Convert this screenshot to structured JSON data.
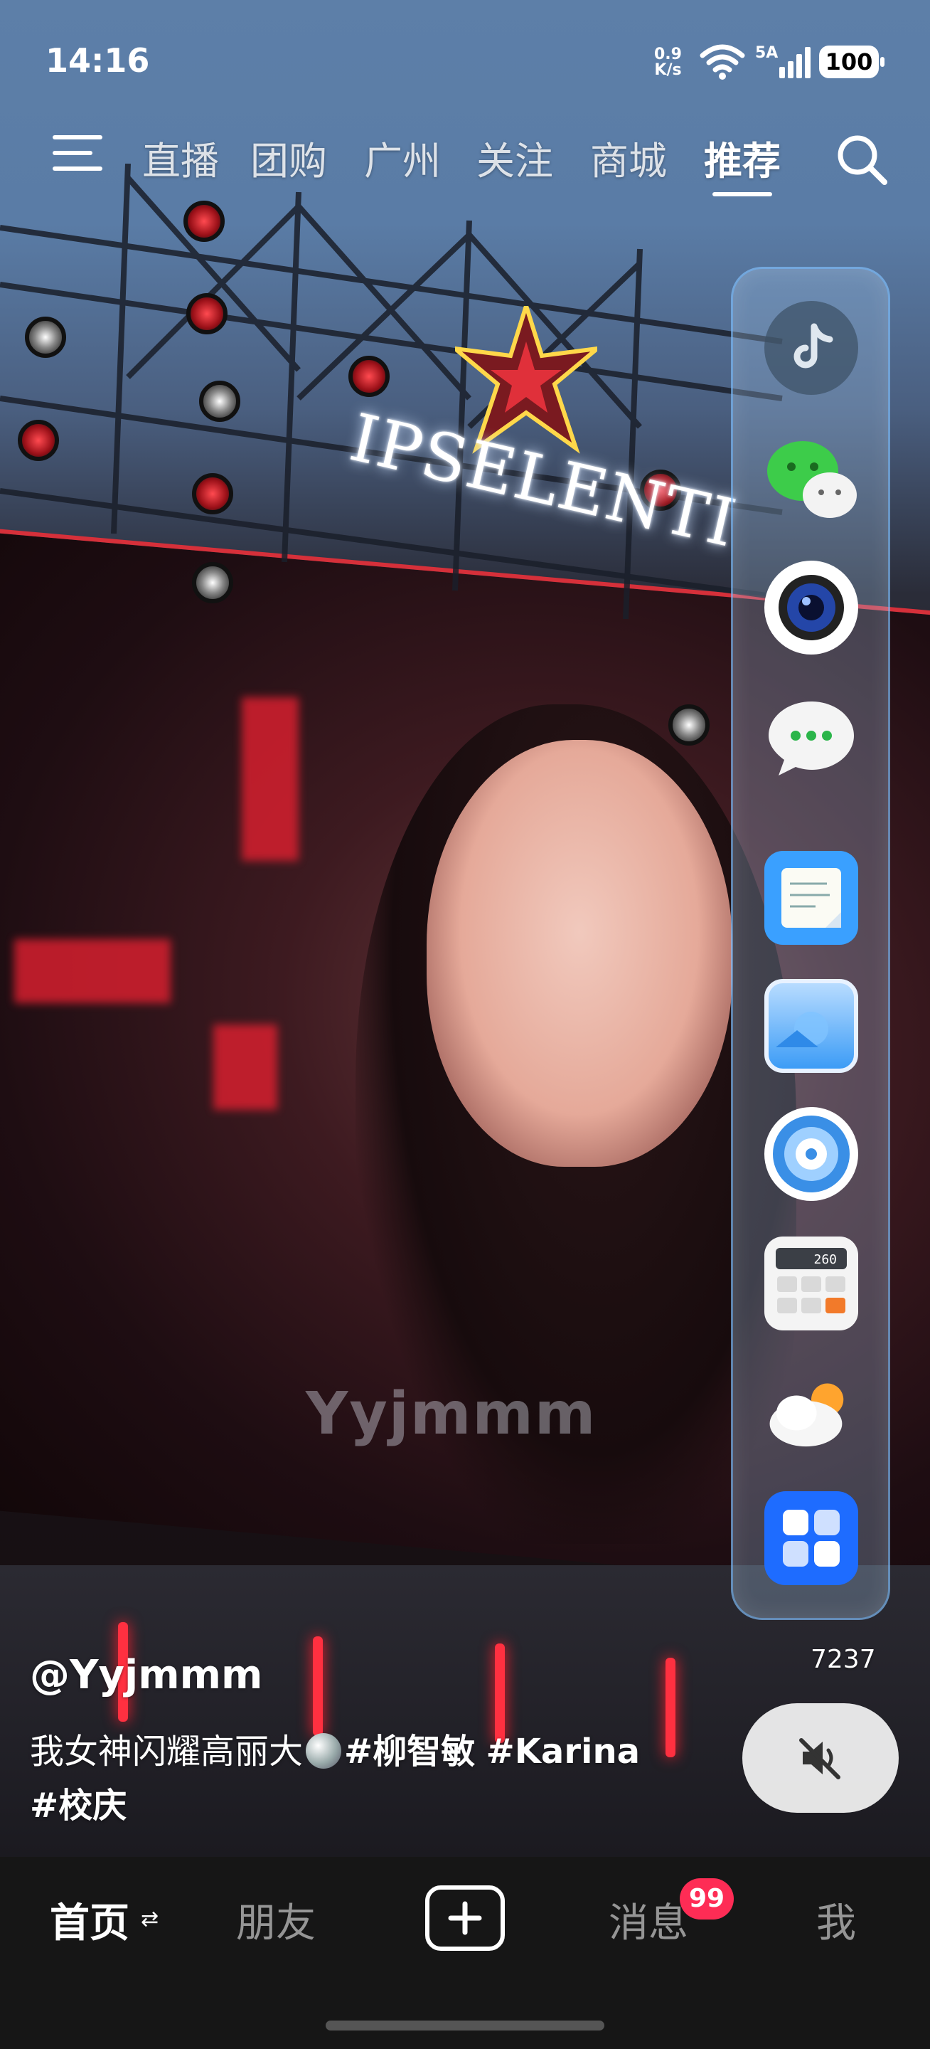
{
  "status_bar": {
    "time": "14:16",
    "net_speed_value": "0.9",
    "net_speed_unit": "K/s",
    "signal_label": "5A",
    "battery": "100"
  },
  "top_nav": {
    "tabs": [
      {
        "label": "直播"
      },
      {
        "label": "团购"
      },
      {
        "label": "广州"
      },
      {
        "label": "关注"
      },
      {
        "label": "商城"
      },
      {
        "label": "推荐"
      }
    ],
    "active_tab": "推荐"
  },
  "video": {
    "sign_text": "IPSELENTI",
    "watermark": "Yyjmmm"
  },
  "dock": {
    "apps": [
      "tiktok-icon",
      "wechat-icon",
      "camera-icon",
      "messages-icon",
      "notes-icon",
      "gallery-icon",
      "music-icon",
      "calculator-icon",
      "weather-icon",
      "more-apps-icon"
    ],
    "calc_display": "260"
  },
  "side": {
    "count": "7237"
  },
  "caption": {
    "author": "@Yyjmmm",
    "text": "我女神闪耀高丽大",
    "tag1": "#柳智敏",
    "tag2": "#Karina",
    "tag3": "#校庆"
  },
  "bottom_bar": {
    "home": "首页",
    "friends": "朋友",
    "messages": "消息",
    "messages_badge": "99",
    "me": "我"
  },
  "colors": {
    "badge": "#fe2c55",
    "dock_border": "#78beff"
  }
}
